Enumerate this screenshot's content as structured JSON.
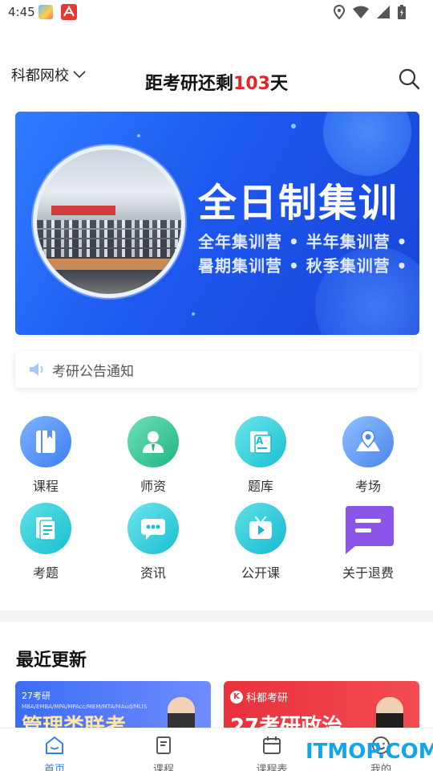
{
  "status_bar": {
    "time": "4:45"
  },
  "header": {
    "school": "科都网校",
    "countdown_prefix": "距考研还剩",
    "countdown_days": "103",
    "countdown_suffix": "天"
  },
  "banner": {
    "photo_sign": "科都2022年考研集训",
    "title": "全日制集训",
    "line1": "全年集训营 • 半年集训营 •",
    "line2": "暑期集训营 • 秋季集训营 •"
  },
  "notice": {
    "text": "考研公告通知"
  },
  "grid": [
    {
      "label": "课程",
      "icon": "book-icon",
      "color": "#5b8ff5"
    },
    {
      "label": "师资",
      "icon": "teacher-icon",
      "color": "#34c59a"
    },
    {
      "label": "题库",
      "icon": "question-bank-icon",
      "color": "#2fcfd8"
    },
    {
      "label": "考场",
      "icon": "map-location-icon",
      "color": "#5e9cf2"
    },
    {
      "label": "考题",
      "icon": "document-icon",
      "color": "#2ecfd6"
    },
    {
      "label": "资讯",
      "icon": "chat-icon",
      "color": "#2fcfd8"
    },
    {
      "label": "公开课",
      "icon": "tv-play-icon",
      "color": "#2fc7df"
    },
    {
      "label": "关于退费",
      "icon": "message-icon",
      "color": "#8a55e8"
    }
  ],
  "recent": {
    "title": "最近更新",
    "cards": [
      {
        "tag": "27考研",
        "small": "MBA/EMBA/MPA/MPAcc/MEM/MTA/MAud/MLIS",
        "big": "管理类联考"
      },
      {
        "brand": "科都考研",
        "big": "27考研政治"
      }
    ]
  },
  "tabbar": [
    {
      "label": "首页",
      "icon": "home-icon",
      "active": true
    },
    {
      "label": "课程",
      "icon": "book-icon",
      "active": false
    },
    {
      "label": "课程表",
      "icon": "calendar-icon",
      "active": false
    },
    {
      "label": "我的",
      "icon": "smiley-icon",
      "active": false
    }
  ],
  "watermark": "ITMOP.COM",
  "colors": {
    "accent": "#2d7ff9",
    "countdown": "#e0262b",
    "banner": "#1d58ee"
  }
}
